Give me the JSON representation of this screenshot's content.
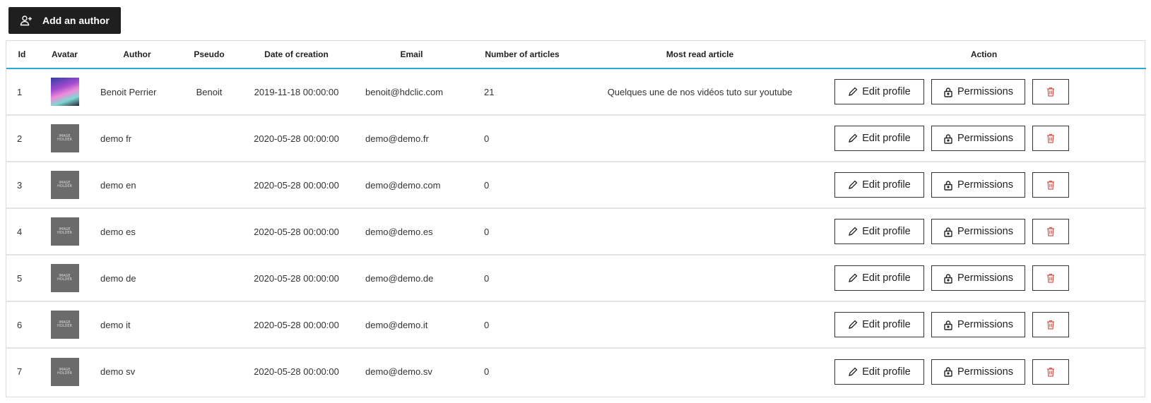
{
  "toolbar": {
    "add_author_label": "Add an author"
  },
  "table": {
    "headers": {
      "id": "Id",
      "avatar": "Avatar",
      "author": "Author",
      "pseudo": "Pseudo",
      "date": "Date of creation",
      "email": "Email",
      "num_articles": "Number of articles",
      "most_read": "Most read article",
      "action": "Action"
    },
    "rows": [
      {
        "id": "1",
        "author": "Benoit Perrier",
        "pseudo": "Benoit",
        "date": "2019-11-18 00:00:00",
        "email": "benoit@hdclic.com",
        "num_articles": "21",
        "most_read": "Quelques une de nos vidéos tuto sur youtube",
        "edit_label": "Edit profile",
        "perm_label": "Permissions"
      },
      {
        "id": "2",
        "author": "demo fr",
        "pseudo": "",
        "date": "2020-05-28 00:00:00",
        "email": "demo@demo.fr",
        "num_articles": "0",
        "most_read": "",
        "edit_label": "Edit profile",
        "perm_label": "Permissions"
      },
      {
        "id": "3",
        "author": "demo en",
        "pseudo": "",
        "date": "2020-05-28 00:00:00",
        "email": "demo@demo.com",
        "num_articles": "0",
        "most_read": "",
        "edit_label": "Edit profile",
        "perm_label": "Permissions"
      },
      {
        "id": "4",
        "author": "demo es",
        "pseudo": "",
        "date": "2020-05-28 00:00:00",
        "email": "demo@demo.es",
        "num_articles": "0",
        "most_read": "",
        "edit_label": "Edit profile",
        "perm_label": "Permissions"
      },
      {
        "id": "5",
        "author": "demo de",
        "pseudo": "",
        "date": "2020-05-28 00:00:00",
        "email": "demo@demo.de",
        "num_articles": "0",
        "most_read": "",
        "edit_label": "Edit profile",
        "perm_label": "Permissions"
      },
      {
        "id": "6",
        "author": "demo it",
        "pseudo": "",
        "date": "2020-05-28 00:00:00",
        "email": "demo@demo.it",
        "num_articles": "0",
        "most_read": "",
        "edit_label": "Edit profile",
        "perm_label": "Permissions"
      },
      {
        "id": "7",
        "author": "demo sv",
        "pseudo": "",
        "date": "2020-05-28 00:00:00",
        "email": "demo@demo.sv",
        "num_articles": "0",
        "most_read": "",
        "edit_label": "Edit profile",
        "perm_label": "Permissions"
      }
    ]
  },
  "icons": {
    "add_author": "user-plus-icon",
    "edit": "pencil-icon",
    "permissions": "lock-icon",
    "delete": "trash-icon"
  },
  "colors": {
    "primary_button_bg": "#1f1f1f",
    "header_underline": "#29a9d6",
    "delete_icon": "#d9534f",
    "avatar_placeholder": "#6b6b6b"
  }
}
